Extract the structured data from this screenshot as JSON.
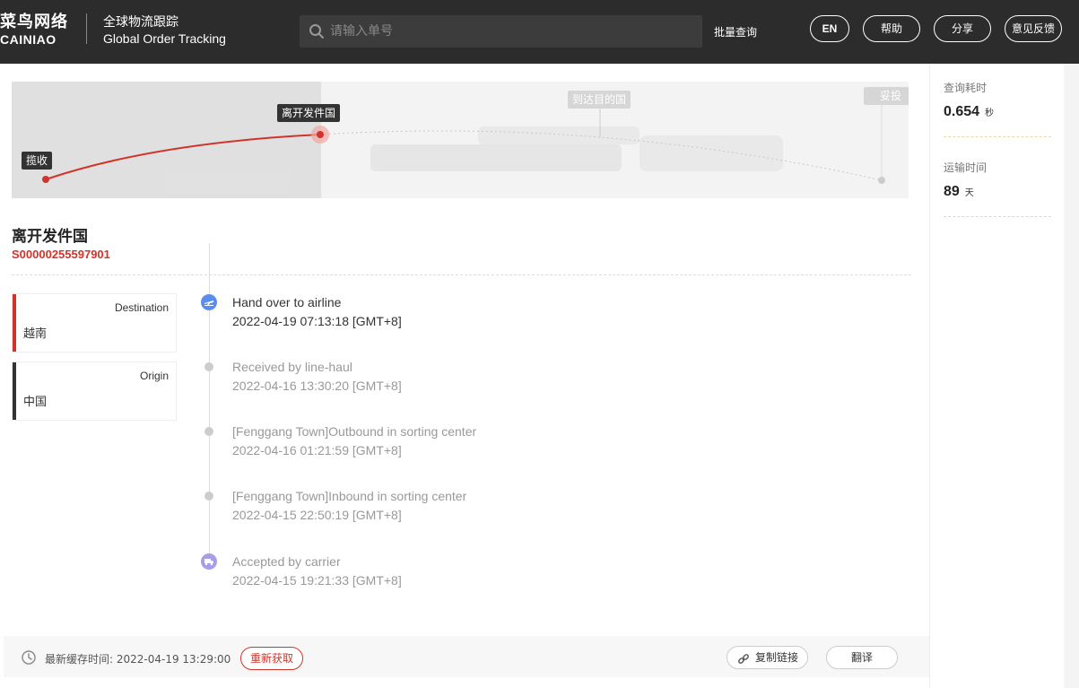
{
  "header": {
    "logo_cn": "菜鸟网络",
    "logo_en": "CAINIAO",
    "title_cn": "全球物流跟踪",
    "title_en": "Global Order Tracking",
    "search_placeholder": "请输入单号",
    "batch_label": "批量查询",
    "lang_label": "EN",
    "help_label": "帮助",
    "share_label": "分享",
    "feedback_label": "意见反馈"
  },
  "map": {
    "stages": [
      "揽收",
      "离开发件国",
      "到达目的国",
      "妥投"
    ],
    "current_stage": "离开发件国",
    "accent": "#d0342c"
  },
  "shipment": {
    "status_title": "离开发件国",
    "tracking_no": "S00000255597901"
  },
  "destination": {
    "label": "Destination",
    "value": "越南",
    "color": "#d0342c"
  },
  "origin": {
    "label": "Origin",
    "value": "中国",
    "color": "#333333"
  },
  "events": [
    {
      "desc": "Hand over to airline",
      "time": "2022-04-19 07:13:18 [GMT+8]",
      "icon": "plane-icon",
      "icon_color": "#5b8def"
    },
    {
      "desc": "Received by line-haul",
      "time": "2022-04-16 13:30:20 [GMT+8]",
      "icon": "dot-icon"
    },
    {
      "desc": "[Fenggang Town]Outbound in sorting center",
      "time": "2022-04-16 01:21:59 [GMT+8]",
      "icon": "dot-icon"
    },
    {
      "desc": "[Fenggang Town]Inbound in sorting center",
      "time": "2022-04-15 22:50:19 [GMT+8]",
      "icon": "dot-icon"
    },
    {
      "desc": "Accepted by carrier",
      "time": "2022-04-15 19:21:33 [GMT+8]",
      "icon": "truck-icon",
      "icon_color": "#a89ee8"
    }
  ],
  "footer": {
    "cache_text": "最新缓存时间: 2022-04-19 13:29:00",
    "refetch_label": "重新获取",
    "copy_link_label": "复制链接",
    "translate_label": "翻译"
  },
  "stats": {
    "query_time_label": "查询耗时",
    "query_time_value": "0.654",
    "query_time_unit": "秒",
    "transit_label": "运输时间",
    "transit_value": "89",
    "transit_unit": "天"
  }
}
